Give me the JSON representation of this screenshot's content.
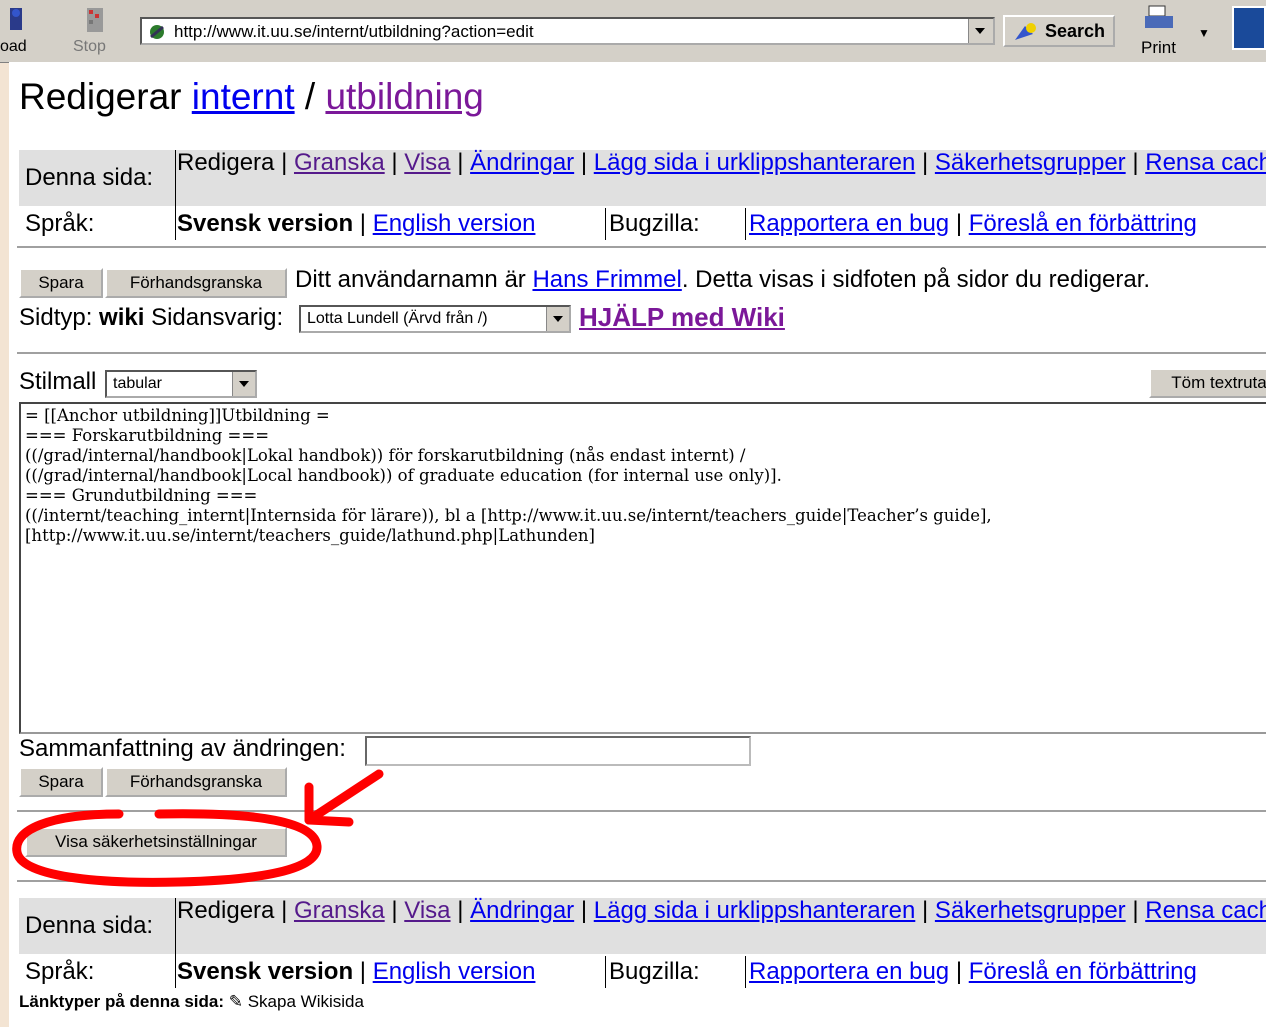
{
  "browser": {
    "reload_label": "oad",
    "stop_label": "Stop",
    "url": "http://www.it.uu.se/internt/utbildning?action=edit",
    "search_label": "Search",
    "print_label": "Print"
  },
  "title": {
    "prefix": "Redigerar",
    "link1": "internt",
    "slash": "/",
    "link2": "utbildning"
  },
  "nav": {
    "page_label": "Denna sida:",
    "edit": "Redigera",
    "review": "Granska",
    "view": "Visa",
    "changes": "Ändringar",
    "clipboard": "Lägg sida i urklippshanteraren",
    "security_groups": "Säkerhetsgrupper",
    "clear_cache": "Rensa cache",
    "language_label": "Språk:",
    "swedish": "Svensk version",
    "english": "English version",
    "bugzilla_label": "Bugzilla:",
    "report_bug": "Rapportera en bug",
    "suggest": "Föreslå en förbättring"
  },
  "editor": {
    "save": "Spara",
    "preview": "Förhandsgranska",
    "username_pre": "Ditt användarnamn är",
    "username": "Hans Frimmel",
    "username_post": ". Detta visas i sidfoten på sidor du redigerar.",
    "pagetype_label": "Sidtyp:",
    "pagetype": "wiki",
    "responsible_label": "Sidansvarig:",
    "responsible": "Lotta Lundell (Ärvd från /)",
    "help": "HJÄLP med Wiki",
    "style_label": "Stilmall",
    "style_value": "tabular",
    "clear_text": "Töm textruta",
    "content": "= [[Anchor utbildning]]Utbildning =\n=== Forskarutbildning ===\n((/grad/internal/handbook|Lokal handbok)) för forskarutbildning (nås endast internt) /\n((/grad/internal/handbook|Local handbook)) of graduate education (for internal use only)].\n=== Grundutbildning ===\n((/internt/teaching_internt|Internsida för lärare)), bl a [http://www.it.uu.se/internt/teachers_guide|Teacher’s guide], [http://www.it.uu.se/internt/teachers_guide/lathund.php|Lathunden]",
    "summary_label": "Sammanfattning av ändringen:",
    "summary_value": "",
    "security_button": "Visa säkerhetsinställningar"
  },
  "footer": {
    "label": "Länktyper på denna sida:",
    "item": "Skapa Wikisida"
  },
  "colors": {
    "link": "#0000ee",
    "visited": "#7b1899",
    "annotation": "#ff0000",
    "nav_bg": "#e0e0e0"
  }
}
